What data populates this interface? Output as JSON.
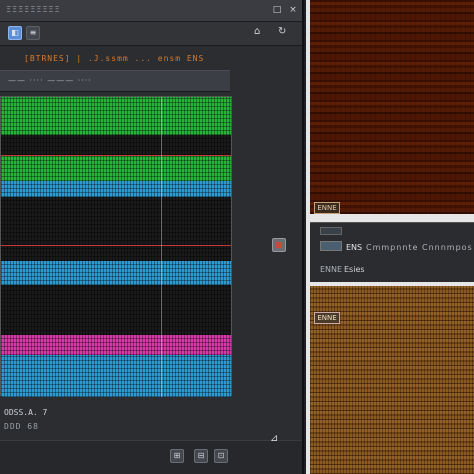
{
  "window": {
    "title": "ΞΞΞΞΞΞΞΞΞ",
    "close_glyph": "×",
    "max_glyph": "□"
  },
  "toolbar": {
    "tool_a": "◧",
    "tool_b": "≡",
    "tool_c": "⌂",
    "tool_d": "↻"
  },
  "path": "[BTRNES] | .J.ssmm ... ensm ENS",
  "subheader": "—— ···· ——— ····",
  "stripes": [
    {
      "color": "#27b43a"
    },
    {
      "color": "#1a1a1a"
    },
    {
      "color": "#27b43a"
    },
    {
      "color": "#2e9ad0"
    },
    {
      "color": "#1a1a1a"
    },
    {
      "color": "#2e9ad0"
    },
    {
      "color": "#1a1a1a"
    },
    {
      "color": "#d63aa8"
    },
    {
      "color": "#2e9ad0"
    }
  ],
  "status": {
    "line1": "ODSS.A.  7",
    "line2": "DDD 68"
  },
  "bottom": {
    "btn1": "⊞",
    "btn2": "⊟",
    "btn3": "⊡",
    "icon_pin": "⊿"
  },
  "right": {
    "wood_tag": "ENNE",
    "info_line1_a": "ENS",
    "info_line1_b": "Cmmpnnte  Cnnnmpos",
    "info_line2_a": "ENNE",
    "info_line2_b": "Esies",
    "bamboo_tag": "ENNE"
  },
  "colors": {
    "accent": "#5d8fd8",
    "path_text": "#d97a2b",
    "redline": "#c43a3a"
  }
}
